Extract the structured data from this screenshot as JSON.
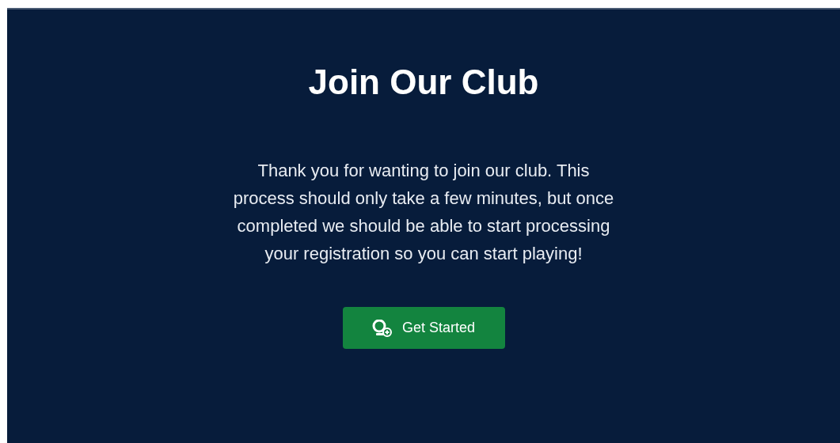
{
  "title": "Join Our Club",
  "intro": "Thank you for wanting to join our club. This process should only take a few minutes, but once completed we should be able to start processing your registration so you can start playing!",
  "button": {
    "label": "Get Started"
  }
}
